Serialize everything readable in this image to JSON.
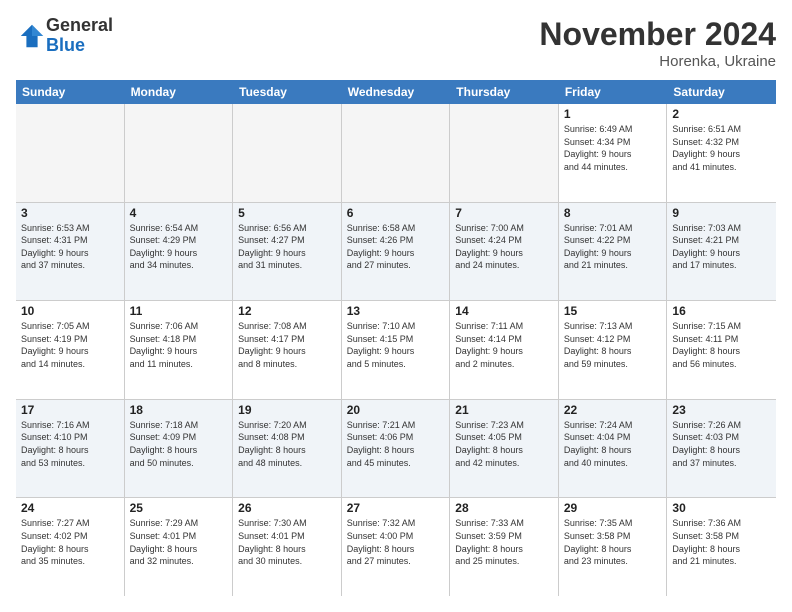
{
  "logo": {
    "general": "General",
    "blue": "Blue"
  },
  "header": {
    "month": "November 2024",
    "location": "Horenka, Ukraine"
  },
  "days_of_week": [
    "Sunday",
    "Monday",
    "Tuesday",
    "Wednesday",
    "Thursday",
    "Friday",
    "Saturday"
  ],
  "weeks": [
    [
      {
        "day": "",
        "info": "",
        "empty": true
      },
      {
        "day": "",
        "info": "",
        "empty": true
      },
      {
        "day": "",
        "info": "",
        "empty": true
      },
      {
        "day": "",
        "info": "",
        "empty": true
      },
      {
        "day": "",
        "info": "",
        "empty": true
      },
      {
        "day": "1",
        "info": "Sunrise: 6:49 AM\nSunset: 4:34 PM\nDaylight: 9 hours\nand 44 minutes.",
        "empty": false
      },
      {
        "day": "2",
        "info": "Sunrise: 6:51 AM\nSunset: 4:32 PM\nDaylight: 9 hours\nand 41 minutes.",
        "empty": false
      }
    ],
    [
      {
        "day": "3",
        "info": "Sunrise: 6:53 AM\nSunset: 4:31 PM\nDaylight: 9 hours\nand 37 minutes.",
        "empty": false
      },
      {
        "day": "4",
        "info": "Sunrise: 6:54 AM\nSunset: 4:29 PM\nDaylight: 9 hours\nand 34 minutes.",
        "empty": false
      },
      {
        "day": "5",
        "info": "Sunrise: 6:56 AM\nSunset: 4:27 PM\nDaylight: 9 hours\nand 31 minutes.",
        "empty": false
      },
      {
        "day": "6",
        "info": "Sunrise: 6:58 AM\nSunset: 4:26 PM\nDaylight: 9 hours\nand 27 minutes.",
        "empty": false
      },
      {
        "day": "7",
        "info": "Sunrise: 7:00 AM\nSunset: 4:24 PM\nDaylight: 9 hours\nand 24 minutes.",
        "empty": false
      },
      {
        "day": "8",
        "info": "Sunrise: 7:01 AM\nSunset: 4:22 PM\nDaylight: 9 hours\nand 21 minutes.",
        "empty": false
      },
      {
        "day": "9",
        "info": "Sunrise: 7:03 AM\nSunset: 4:21 PM\nDaylight: 9 hours\nand 17 minutes.",
        "empty": false
      }
    ],
    [
      {
        "day": "10",
        "info": "Sunrise: 7:05 AM\nSunset: 4:19 PM\nDaylight: 9 hours\nand 14 minutes.",
        "empty": false
      },
      {
        "day": "11",
        "info": "Sunrise: 7:06 AM\nSunset: 4:18 PM\nDaylight: 9 hours\nand 11 minutes.",
        "empty": false
      },
      {
        "day": "12",
        "info": "Sunrise: 7:08 AM\nSunset: 4:17 PM\nDaylight: 9 hours\nand 8 minutes.",
        "empty": false
      },
      {
        "day": "13",
        "info": "Sunrise: 7:10 AM\nSunset: 4:15 PM\nDaylight: 9 hours\nand 5 minutes.",
        "empty": false
      },
      {
        "day": "14",
        "info": "Sunrise: 7:11 AM\nSunset: 4:14 PM\nDaylight: 9 hours\nand 2 minutes.",
        "empty": false
      },
      {
        "day": "15",
        "info": "Sunrise: 7:13 AM\nSunset: 4:12 PM\nDaylight: 8 hours\nand 59 minutes.",
        "empty": false
      },
      {
        "day": "16",
        "info": "Sunrise: 7:15 AM\nSunset: 4:11 PM\nDaylight: 8 hours\nand 56 minutes.",
        "empty": false
      }
    ],
    [
      {
        "day": "17",
        "info": "Sunrise: 7:16 AM\nSunset: 4:10 PM\nDaylight: 8 hours\nand 53 minutes.",
        "empty": false
      },
      {
        "day": "18",
        "info": "Sunrise: 7:18 AM\nSunset: 4:09 PM\nDaylight: 8 hours\nand 50 minutes.",
        "empty": false
      },
      {
        "day": "19",
        "info": "Sunrise: 7:20 AM\nSunset: 4:08 PM\nDaylight: 8 hours\nand 48 minutes.",
        "empty": false
      },
      {
        "day": "20",
        "info": "Sunrise: 7:21 AM\nSunset: 4:06 PM\nDaylight: 8 hours\nand 45 minutes.",
        "empty": false
      },
      {
        "day": "21",
        "info": "Sunrise: 7:23 AM\nSunset: 4:05 PM\nDaylight: 8 hours\nand 42 minutes.",
        "empty": false
      },
      {
        "day": "22",
        "info": "Sunrise: 7:24 AM\nSunset: 4:04 PM\nDaylight: 8 hours\nand 40 minutes.",
        "empty": false
      },
      {
        "day": "23",
        "info": "Sunrise: 7:26 AM\nSunset: 4:03 PM\nDaylight: 8 hours\nand 37 minutes.",
        "empty": false
      }
    ],
    [
      {
        "day": "24",
        "info": "Sunrise: 7:27 AM\nSunset: 4:02 PM\nDaylight: 8 hours\nand 35 minutes.",
        "empty": false
      },
      {
        "day": "25",
        "info": "Sunrise: 7:29 AM\nSunset: 4:01 PM\nDaylight: 8 hours\nand 32 minutes.",
        "empty": false
      },
      {
        "day": "26",
        "info": "Sunrise: 7:30 AM\nSunset: 4:01 PM\nDaylight: 8 hours\nand 30 minutes.",
        "empty": false
      },
      {
        "day": "27",
        "info": "Sunrise: 7:32 AM\nSunset: 4:00 PM\nDaylight: 8 hours\nand 27 minutes.",
        "empty": false
      },
      {
        "day": "28",
        "info": "Sunrise: 7:33 AM\nSunset: 3:59 PM\nDaylight: 8 hours\nand 25 minutes.",
        "empty": false
      },
      {
        "day": "29",
        "info": "Sunrise: 7:35 AM\nSunset: 3:58 PM\nDaylight: 8 hours\nand 23 minutes.",
        "empty": false
      },
      {
        "day": "30",
        "info": "Sunrise: 7:36 AM\nSunset: 3:58 PM\nDaylight: 8 hours\nand 21 minutes.",
        "empty": false
      }
    ]
  ]
}
